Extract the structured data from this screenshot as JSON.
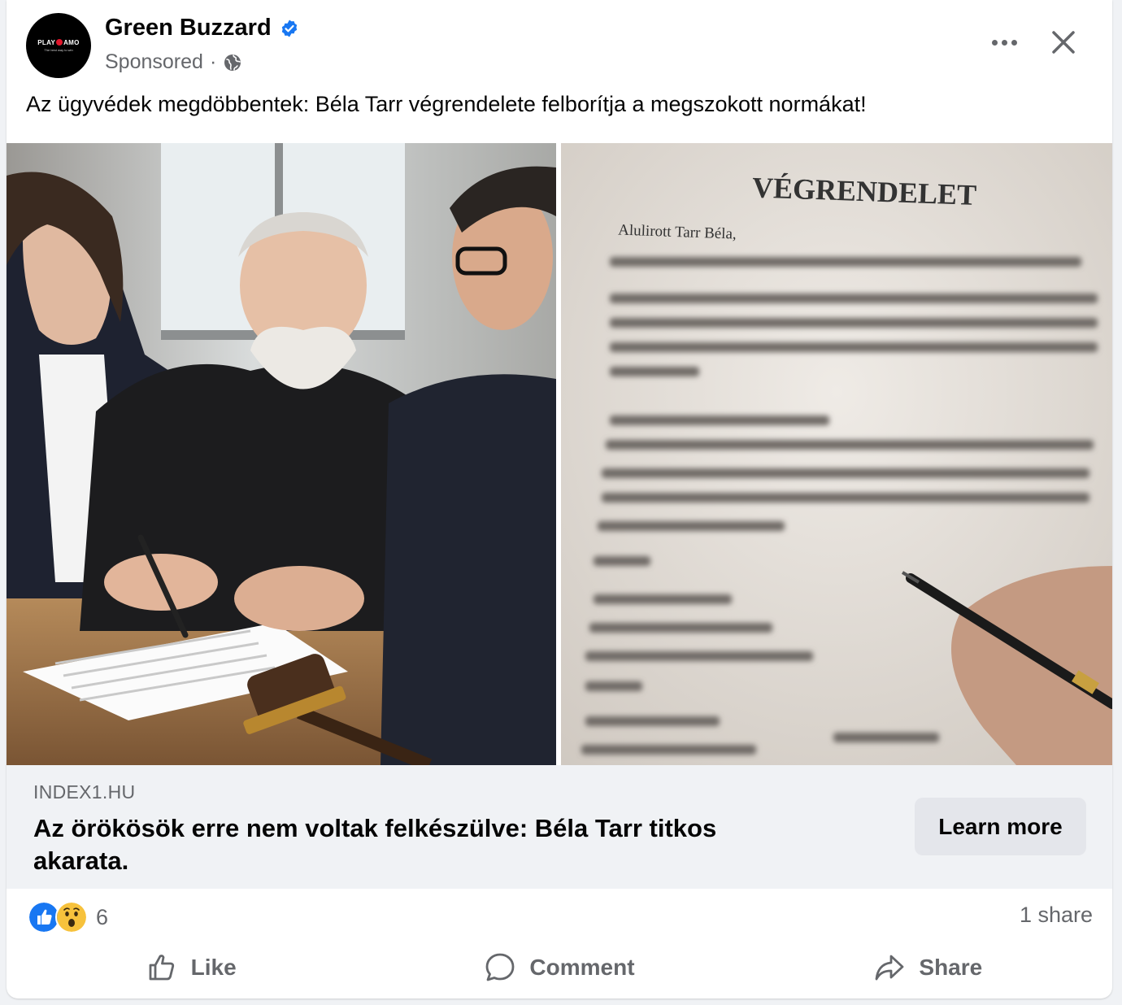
{
  "post": {
    "page_name": "Green Buzzard",
    "verified_icon": "verified-badge-icon",
    "sponsored_label": "Sponsored",
    "separator": "·",
    "audience_icon": "globe-icon",
    "text": "Az ügyvédek megdöbbentek: Béla Tarr végrendelete felborítja a megszokott normákat!",
    "avatar": {
      "logo_left": "PLAY",
      "logo_right": "AMO",
      "tagline": "The best way to win"
    }
  },
  "image": {
    "left_description": "photo-elderly-man-signing",
    "right_document_title": "VÉGRENDELET",
    "right_document_first_line": "Alulirott Tarr Béla,"
  },
  "link": {
    "domain": "INDEX1.HU",
    "title": "Az örökösök erre nem voltak felkészülve: Béla Tarr titkos akarata.",
    "cta_label": "Learn more"
  },
  "stats": {
    "reaction_icons": [
      "like-reaction-icon",
      "wow-reaction-icon"
    ],
    "reaction_count": "6",
    "shares": "1 share"
  },
  "actions": {
    "like": "Like",
    "comment": "Comment",
    "share": "Share"
  },
  "colors": {
    "brand_blue": "#1877f2",
    "secondary_text": "#65676b",
    "link_bg": "#f0f2f5",
    "button_bg": "#e4e6eb"
  }
}
